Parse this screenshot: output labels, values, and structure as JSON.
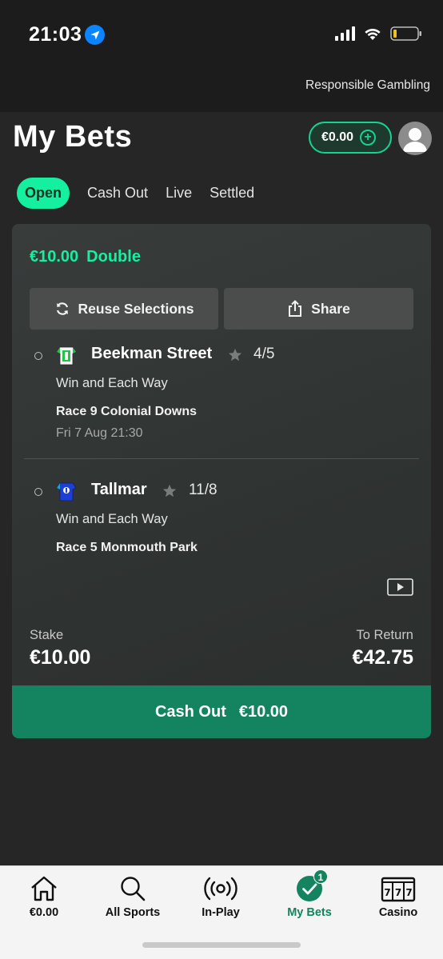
{
  "status_bar": {
    "time": "21:03"
  },
  "top_bar": {
    "responsible_gambling": "Responsible Gambling"
  },
  "header": {
    "title": "My Bets",
    "balance": "€0.00"
  },
  "tabs": [
    {
      "label": "Open",
      "active": true
    },
    {
      "label": "Cash Out",
      "active": false
    },
    {
      "label": "Live",
      "active": false
    },
    {
      "label": "Settled",
      "active": false
    }
  ],
  "bet": {
    "stake_amount": "€10.00",
    "bet_type": "Double",
    "reuse_label": "Reuse Selections",
    "share_label": "Share",
    "selections": [
      {
        "horse": "Beekman Street",
        "odds": "4/5",
        "market": "Win and Each Way",
        "race": "Race 9 Colonial Downs",
        "date": "Fri 7 Aug 21:30"
      },
      {
        "horse": "Tallmar",
        "odds": "11/8",
        "market": "Win and Each Way",
        "race": "Race 5 Monmouth Park"
      }
    ],
    "stake_label": "Stake",
    "stake_value": "€10.00",
    "return_label": "To Return",
    "return_value": "€42.75",
    "cashout_label": "Cash Out",
    "cashout_value": "€10.00"
  },
  "bottom_nav": [
    {
      "label": "€0.00",
      "icon": "home-icon"
    },
    {
      "label": "All Sports",
      "icon": "search-icon"
    },
    {
      "label": "In-Play",
      "icon": "broadcast-icon"
    },
    {
      "label": "My Bets",
      "icon": "check-circle-icon",
      "active": true,
      "badge": "1"
    },
    {
      "label": "Casino",
      "icon": "slot-machine-icon"
    }
  ],
  "colors": {
    "accent": "#14f0a0",
    "cashout": "#13845f",
    "background": "#262626"
  }
}
